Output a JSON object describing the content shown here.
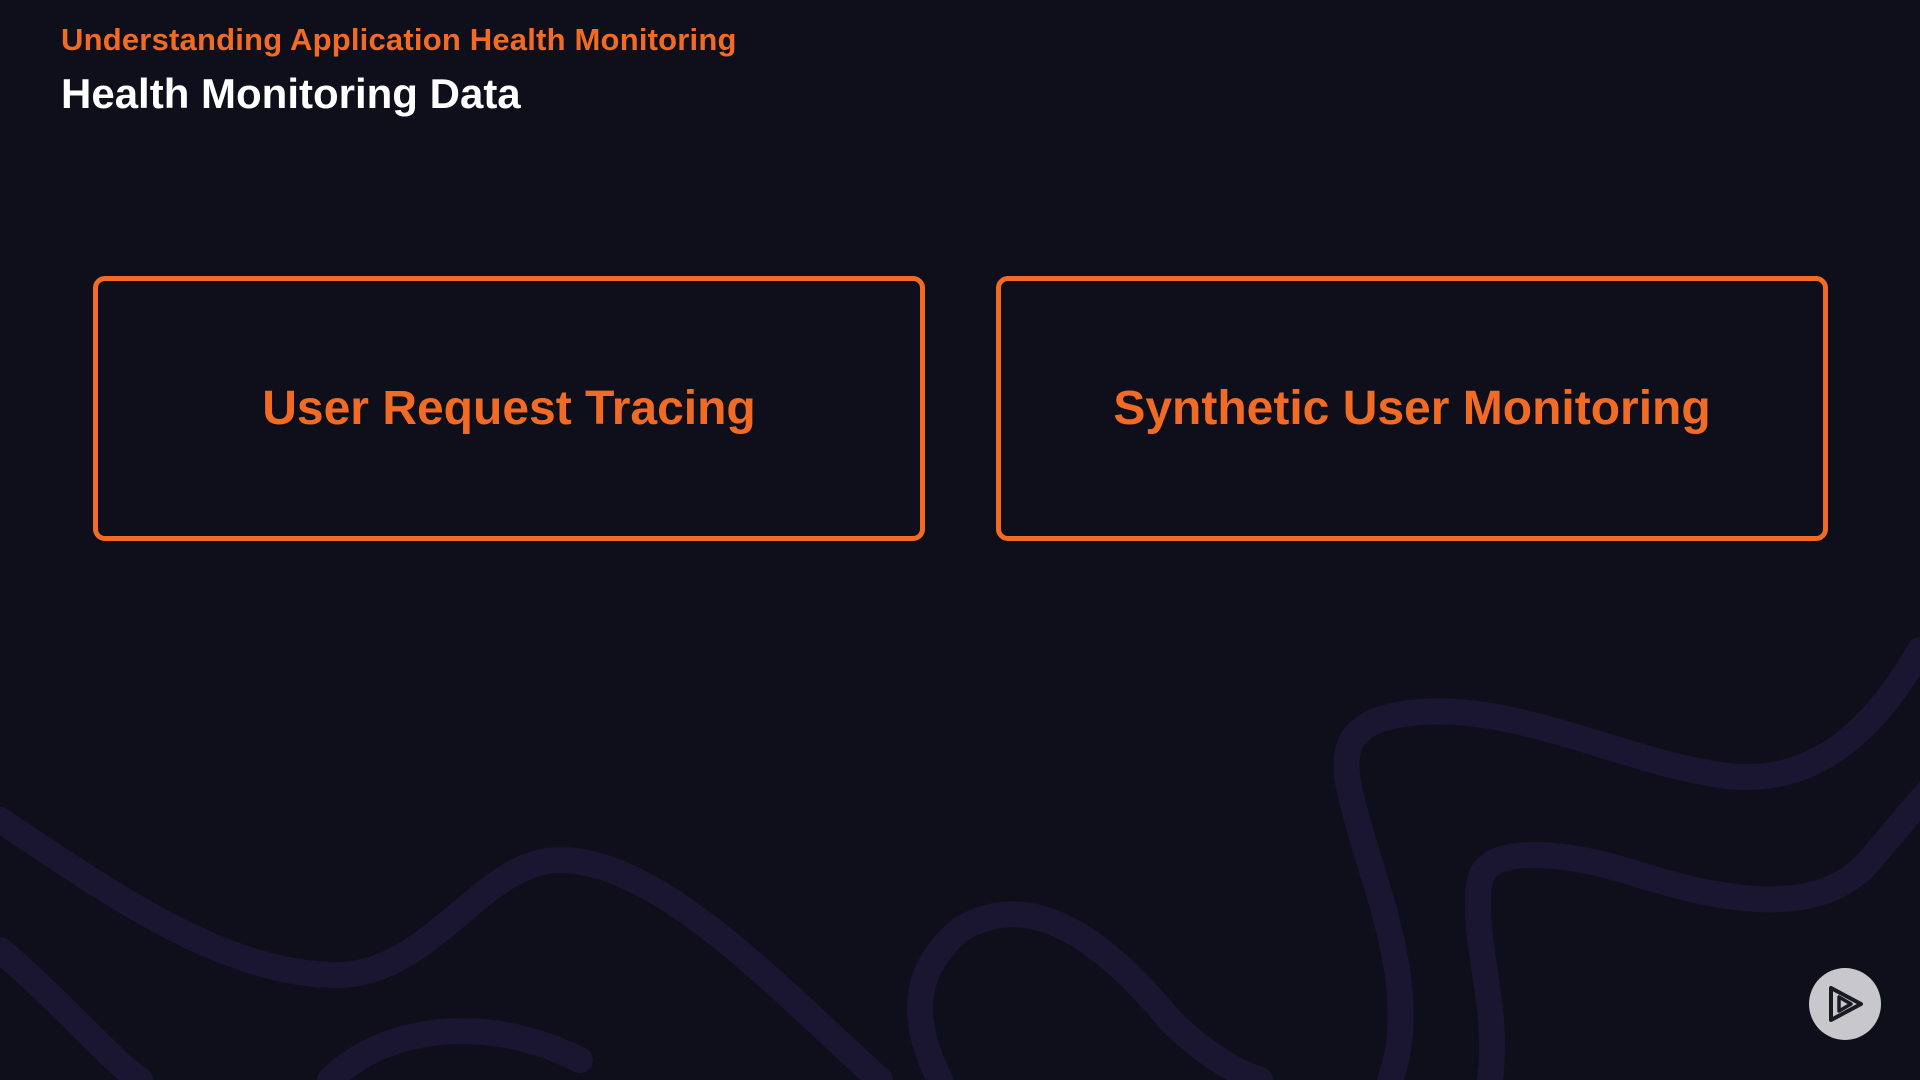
{
  "slide": {
    "section_title": "Understanding Application Health Monitoring",
    "title": "Health Monitoring Data"
  },
  "cards": [
    {
      "label": "User Request Tracing"
    },
    {
      "label": "Synthetic User Monitoring"
    }
  ],
  "branding": {
    "logo_icon": "play-logo-icon"
  },
  "colors": {
    "background": "#0f0f1b",
    "accent": "#f16b24",
    "title": "#ffffff",
    "wave": "#1a1530",
    "logo_bg": "#c8c8cc"
  }
}
